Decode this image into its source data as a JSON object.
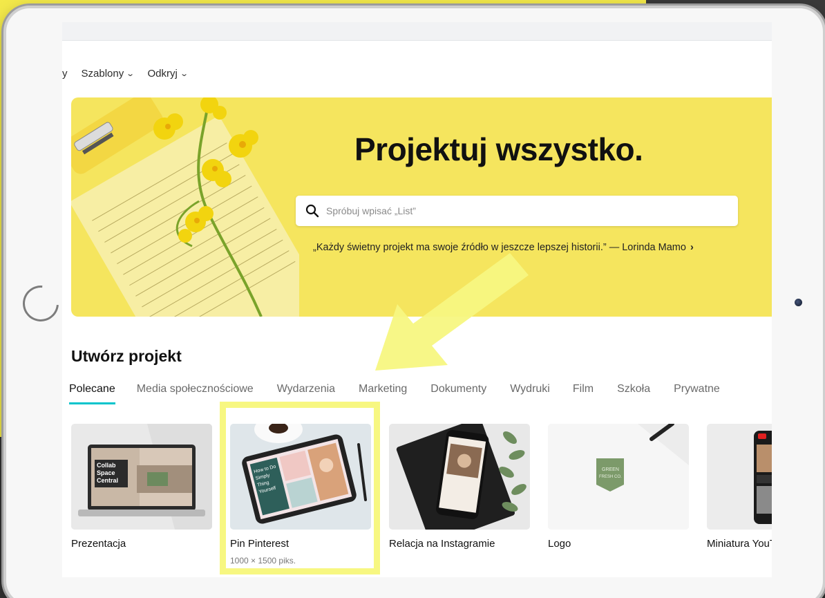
{
  "nav": {
    "truncated_item": "y",
    "items": [
      {
        "label": "Szablony",
        "icon": "chevron-down-icon"
      },
      {
        "label": "Odkryj",
        "icon": "chevron-down-icon"
      }
    ]
  },
  "hero": {
    "title": "Projektuj wszystko.",
    "search_placeholder": "Spróbuj wpisać „List”",
    "quote": "„Każdy świetny projekt ma swoje źródło w jeszcze lepszej historii.” — Lorinda Mamo",
    "quote_arrow": "›"
  },
  "section": {
    "title": "Utwórz projekt",
    "tabs": [
      "Polecane",
      "Media społecznościowe",
      "Wydarzenia",
      "Marketing",
      "Dokumenty",
      "Wydruki",
      "Film",
      "Szkoła",
      "Prywatne"
    ],
    "active_tab": "Polecane"
  },
  "cards": [
    {
      "label": "Prezentacja",
      "thumb_text": [
        "Collab",
        "Space",
        "Central"
      ]
    },
    {
      "label": "Pin Pinterest",
      "dims": "1000 × 1500 piks.",
      "thumb_text": [
        "How to Do",
        "Simply",
        "Thing",
        "Yourself"
      ]
    },
    {
      "label": "Relacja na Instagramie"
    },
    {
      "label": "Logo",
      "thumb_text": [
        "GREEN",
        "FRESH CO."
      ]
    },
    {
      "label": "Miniatura YouTube"
    }
  ],
  "colors": {
    "accent_teal": "#00c4cc",
    "hero_yellow": "#f5e55e",
    "annotation_yellow": "#f7f781",
    "background_yellow": "#f3e94a"
  }
}
